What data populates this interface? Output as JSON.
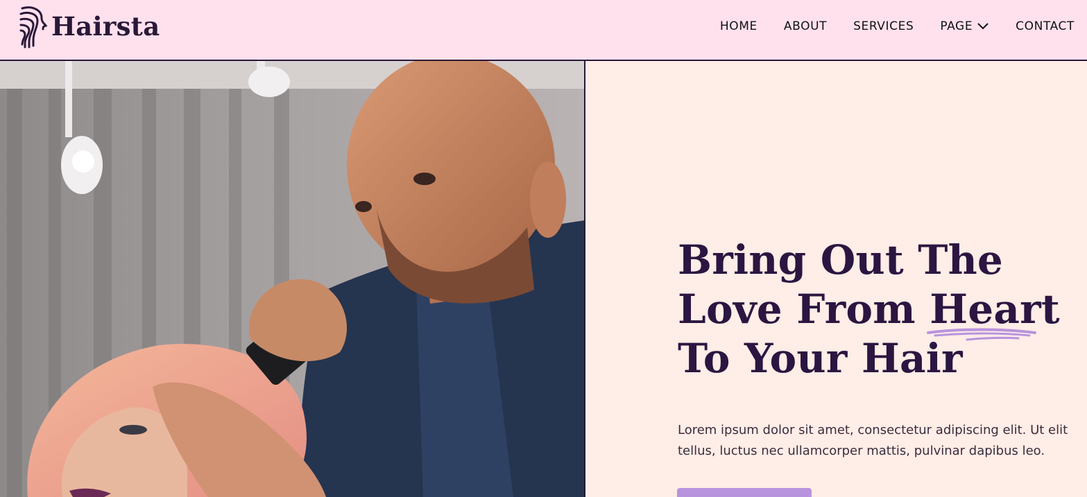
{
  "brand": {
    "name": "Hairsta"
  },
  "nav": {
    "items": [
      {
        "label": "HOME"
      },
      {
        "label": "ABOUT"
      },
      {
        "label": "SERVICES"
      },
      {
        "label": "PAGE"
      },
      {
        "label": "CONTACT"
      }
    ]
  },
  "hero": {
    "headline_part1": "Bring Out The Love From ",
    "headline_highlight": "Heart",
    "headline_part2": " To Your Hair",
    "description": "Lorem ipsum dolor sit amet, consectetur adipiscing elit. Ut elit tellus, luctus nec ullamcorper mattis, pulvinar dapibus leo."
  },
  "colors": {
    "header_bg": "#ffe1ee",
    "hero_bg": "#ffede7",
    "headline": "#2b1641",
    "accent": "#b894de"
  }
}
